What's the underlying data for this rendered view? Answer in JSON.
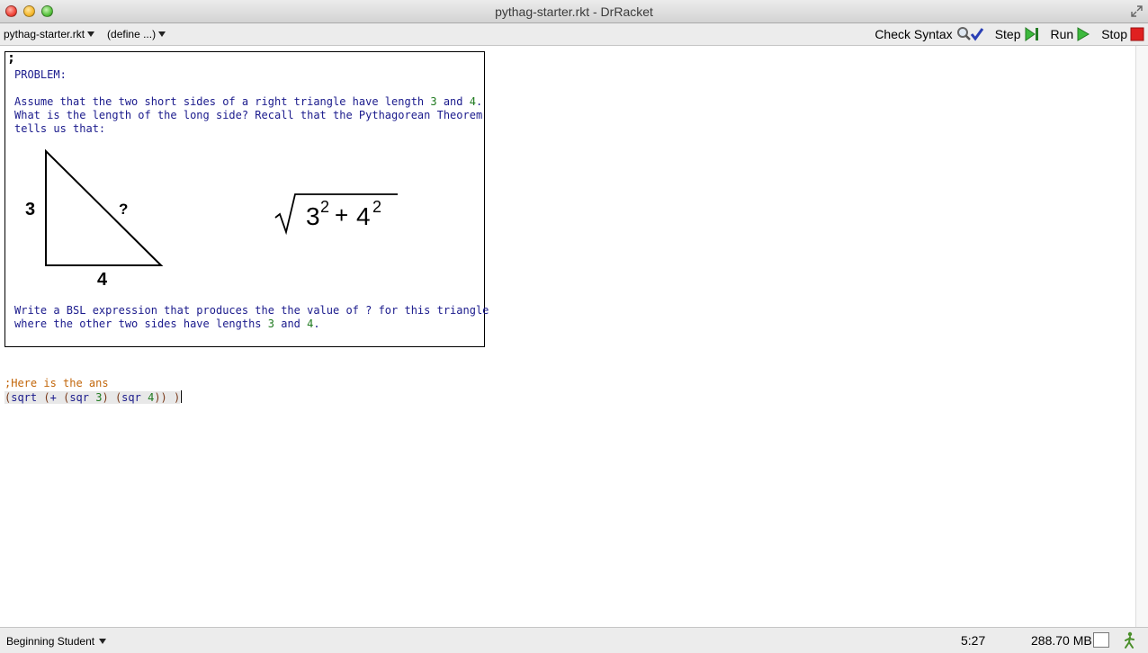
{
  "window": {
    "title": "pythag-starter.rkt - DrRacket"
  },
  "toolbar": {
    "file_menu": "pythag-starter.rkt",
    "define_menu": "(define ...)",
    "check_syntax": "Check Syntax",
    "step": "Step",
    "run": "Run",
    "stop": "Stop"
  },
  "editor": {
    "box_semicolon": ";",
    "problem_heading": "PROBLEM:",
    "para1_line1_a": "Assume that the two short sides of a right triangle have length ",
    "para1_line1_n1": "3",
    "para1_line1_b": " and ",
    "para1_line1_n2": "4",
    "para1_line1_c": ".",
    "para1_line2": "What is the length of the long side? Recall that the Pythagorean Theorem",
    "para1_line3": "tells us that:",
    "triangle": {
      "side_a": "3",
      "side_b": "4",
      "hypotenuse": "?"
    },
    "formula": {
      "base1": "3",
      "exp1": "2",
      "op": "+",
      "base2": "4",
      "exp2": "2"
    },
    "para2_line1": "Write a BSL expression that produces the the value of ? for this triangle",
    "para2_line2_a": "where the other two sides have lengths ",
    "para2_line2_n1": "3",
    "para2_line2_b": " and ",
    "para2_line2_n2": "4",
    "para2_line2_c": ".",
    "answer_comment": ";Here is the ans",
    "code": {
      "open": "(",
      "fn": "sqrt",
      "sp1": " ",
      "open2": "(",
      "plus": "+",
      "sp2": " ",
      "open3": "(",
      "sqr1": "sqr",
      "sp3": " ",
      "arg1": "3",
      "close3": ")",
      "sp4": " ",
      "open4": "(",
      "sqr2": "sqr",
      "sp5": " ",
      "arg2": "4",
      "close4": "))",
      "sp6": " ",
      "close1": ")"
    }
  },
  "status": {
    "language": "Beginning Student",
    "position": "5:27",
    "memory": "288.70 MB"
  },
  "colors": {
    "comment": "#1a1a8c",
    "number": "#1f7a1f",
    "answer_comment": "#c2660a",
    "stop_red": "#e02020",
    "run_green": "#3cb93c"
  }
}
